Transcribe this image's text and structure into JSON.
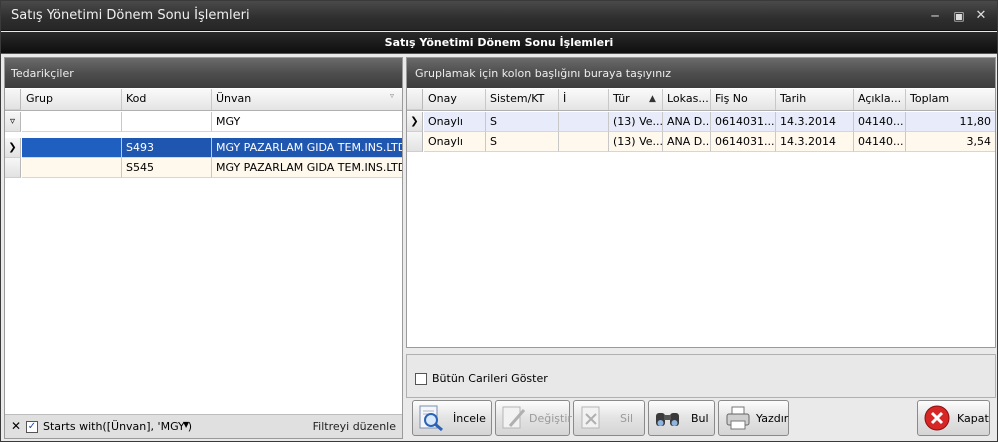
{
  "window": {
    "title": "Satış Yönetimi Dönem Sonu İşlemleri",
    "header": "Satış Yönetimi Dönem Sonu İşlemleri"
  },
  "left_panel": {
    "title": "Tedarikçiler",
    "columns": [
      "Grup",
      "Kod",
      "Ünvan"
    ],
    "filter": {
      "grup": "",
      "kod": "",
      "unvan": "MGY"
    },
    "rows": [
      {
        "grup": "",
        "kod": "S493",
        "unvan": "MGY PAZARLAM GIDA TEM.INS.LTD...."
      },
      {
        "grup": "",
        "kod": "S545",
        "unvan": "MGY PAZARLAM GIDA TEM.INS.LTD...."
      }
    ],
    "filter_bar": {
      "text": "Starts with([Ünvan], 'MGY')",
      "edit_label": "Filtreyi düzenle",
      "checked": true
    }
  },
  "right_panel": {
    "group_hint": "Gruplamak için kolon başlığını buraya taşıyınız",
    "columns": [
      "Onay",
      "Sistem/KT",
      "İ",
      "Tür",
      "Lokas...",
      "Fiş No",
      "Tarih",
      "Açıkla...",
      "Toplam"
    ],
    "rows": [
      {
        "onay": "Onaylı",
        "sistem": "S",
        "i": "",
        "tur": "(13) Ve...",
        "lokasyon": "ANA D...",
        "fis_no": "0614031...",
        "tarih": "14.3.2014",
        "aciklama": "04140...",
        "toplam": "11,80"
      },
      {
        "onay": "Onaylı",
        "sistem": "S",
        "i": "",
        "tur": "(13) Ve...",
        "lokasyon": "ANA D...",
        "fis_no": "0614031...",
        "tarih": "14.3.2014",
        "aciklama": "04140...",
        "toplam": "3,54"
      }
    ]
  },
  "options": {
    "show_all_label": "Bütün Carileri Göster",
    "show_all_checked": false
  },
  "toolbar": {
    "incele": "İncele",
    "degistir": "Değiştir",
    "sil": "Sil",
    "bul": "Bul",
    "yazdir": "Yazdır",
    "kapat": "Kapat"
  },
  "colors": {
    "selection": "#1f5fbf",
    "title_bg": "#2e2e2e"
  }
}
